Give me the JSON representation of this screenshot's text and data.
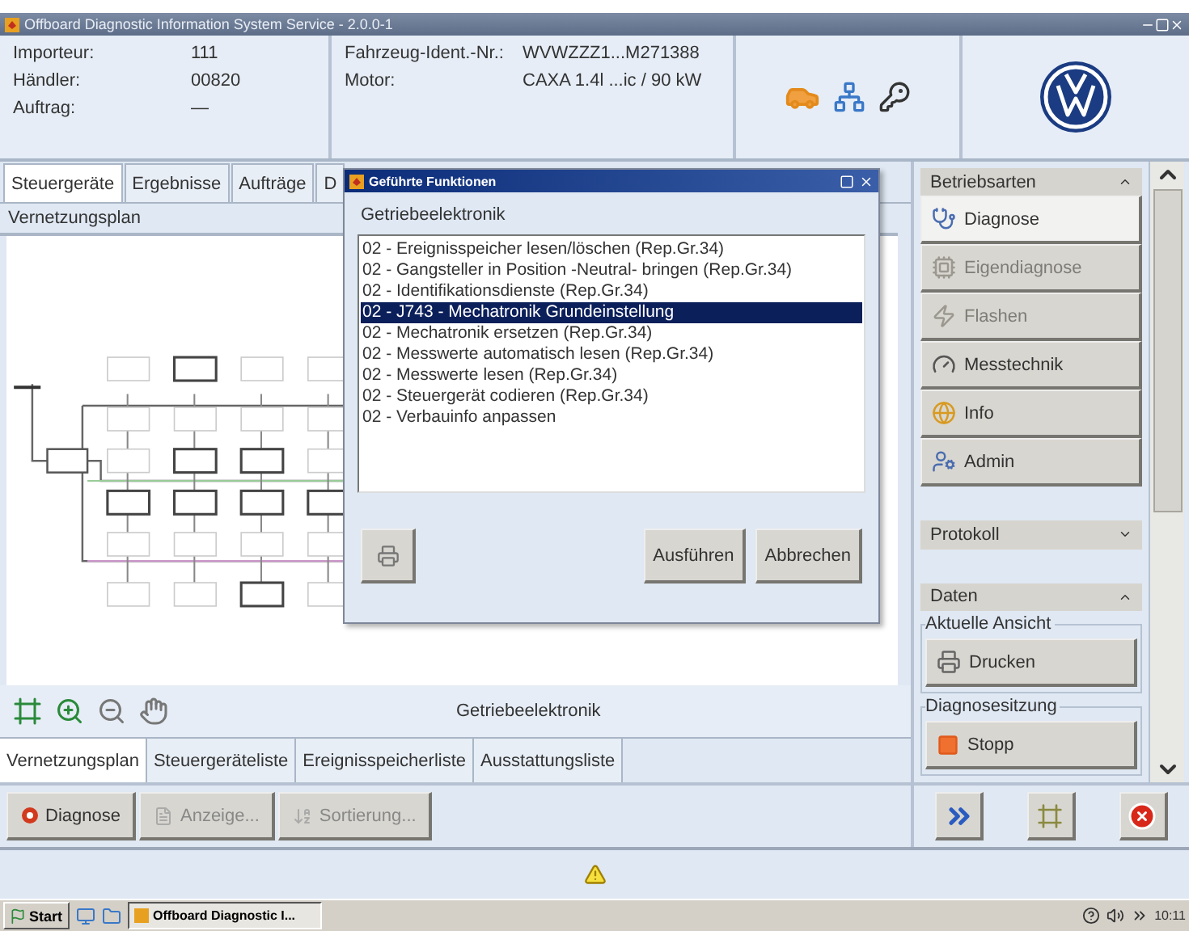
{
  "window": {
    "title": "Offboard Diagnostic Information System Service - 2.0.0-1"
  },
  "header": {
    "info": [
      {
        "label": "Importeur:",
        "value": "111"
      },
      {
        "label": "Händler:",
        "value": "00820"
      },
      {
        "label": "Auftrag:",
        "value": "—"
      }
    ],
    "vehicle": [
      {
        "label": "Fahrzeug-Ident.-Nr.:",
        "value": "WVWZZZ1...M271388"
      },
      {
        "label": "Motor:",
        "value": "CAXA 1.4l ...ic / 90 kW"
      }
    ]
  },
  "tabs": [
    {
      "label": "Steuergeräte",
      "selected": true
    },
    {
      "label": "Ergebnisse",
      "selected": false
    },
    {
      "label": "Aufträge",
      "selected": false
    },
    {
      "label": "D",
      "selected": false
    }
  ],
  "panel_title": "Vernetzungsplan",
  "diagram_caption": "Getriebeelektronik",
  "bottom_tabs": [
    {
      "label": "Vernetzungsplan",
      "selected": true
    },
    {
      "label": "Steuergeräteliste",
      "selected": false
    },
    {
      "label": "Ereignisspeicherliste",
      "selected": false
    },
    {
      "label": "Ausstattungsliste",
      "selected": false
    }
  ],
  "actions": [
    {
      "label": "Diagnose",
      "disabled": false
    },
    {
      "label": "Anzeige...",
      "disabled": true
    },
    {
      "label": "Sortierung...",
      "disabled": true
    }
  ],
  "dialog": {
    "title": "Geführte Funktionen",
    "group": "Getriebeelektronik",
    "items": [
      {
        "label": "02 - Ereignisspeicher lesen/löschen (Rep.Gr.34)",
        "selected": false
      },
      {
        "label": "02 - Gangsteller in Position -Neutral- bringen (Rep.Gr.34)",
        "selected": false
      },
      {
        "label": "02 - Identifikationsdienste (Rep.Gr.34)",
        "selected": false
      },
      {
        "label": "02 - J743 - Mechatronik Grundeinstellung",
        "selected": true
      },
      {
        "label": "02 - Mechatronik ersetzen (Rep.Gr.34)",
        "selected": false
      },
      {
        "label": "02 - Messwerte automatisch lesen (Rep.Gr.34)",
        "selected": false
      },
      {
        "label": "02 - Messwerte lesen (Rep.Gr.34)",
        "selected": false
      },
      {
        "label": "02 - Steuergerät codieren (Rep.Gr.34)",
        "selected": false
      },
      {
        "label": "02 - Verbauinfo anpassen",
        "selected": false
      }
    ],
    "buttons": [
      "Ausführen",
      "Abbrechen"
    ]
  },
  "sidebar": {
    "modes": {
      "title": "Betriebsarten",
      "expanded": true,
      "items": [
        {
          "label": "Diagnose",
          "selected": true,
          "disabled": false
        },
        {
          "label": "Eigendiagnose",
          "selected": false,
          "disabled": true
        },
        {
          "label": "Flashen",
          "selected": false,
          "disabled": true
        },
        {
          "label": "Messtechnik",
          "selected": false,
          "disabled": false
        },
        {
          "label": "Info",
          "selected": false,
          "disabled": false
        },
        {
          "label": "Admin",
          "selected": false,
          "disabled": false
        }
      ]
    },
    "protocol": {
      "title": "Protokoll",
      "expanded": false
    },
    "data": {
      "title": "Daten",
      "expanded": true,
      "groups": [
        {
          "title": "Aktuelle Ansicht",
          "button": "Drucken"
        },
        {
          "title": "Diagnosesitzung",
          "button": "Stopp"
        }
      ]
    }
  },
  "taskbar": {
    "start": "Start",
    "task": "Offboard Diagnostic I...",
    "clock": "10:11"
  }
}
